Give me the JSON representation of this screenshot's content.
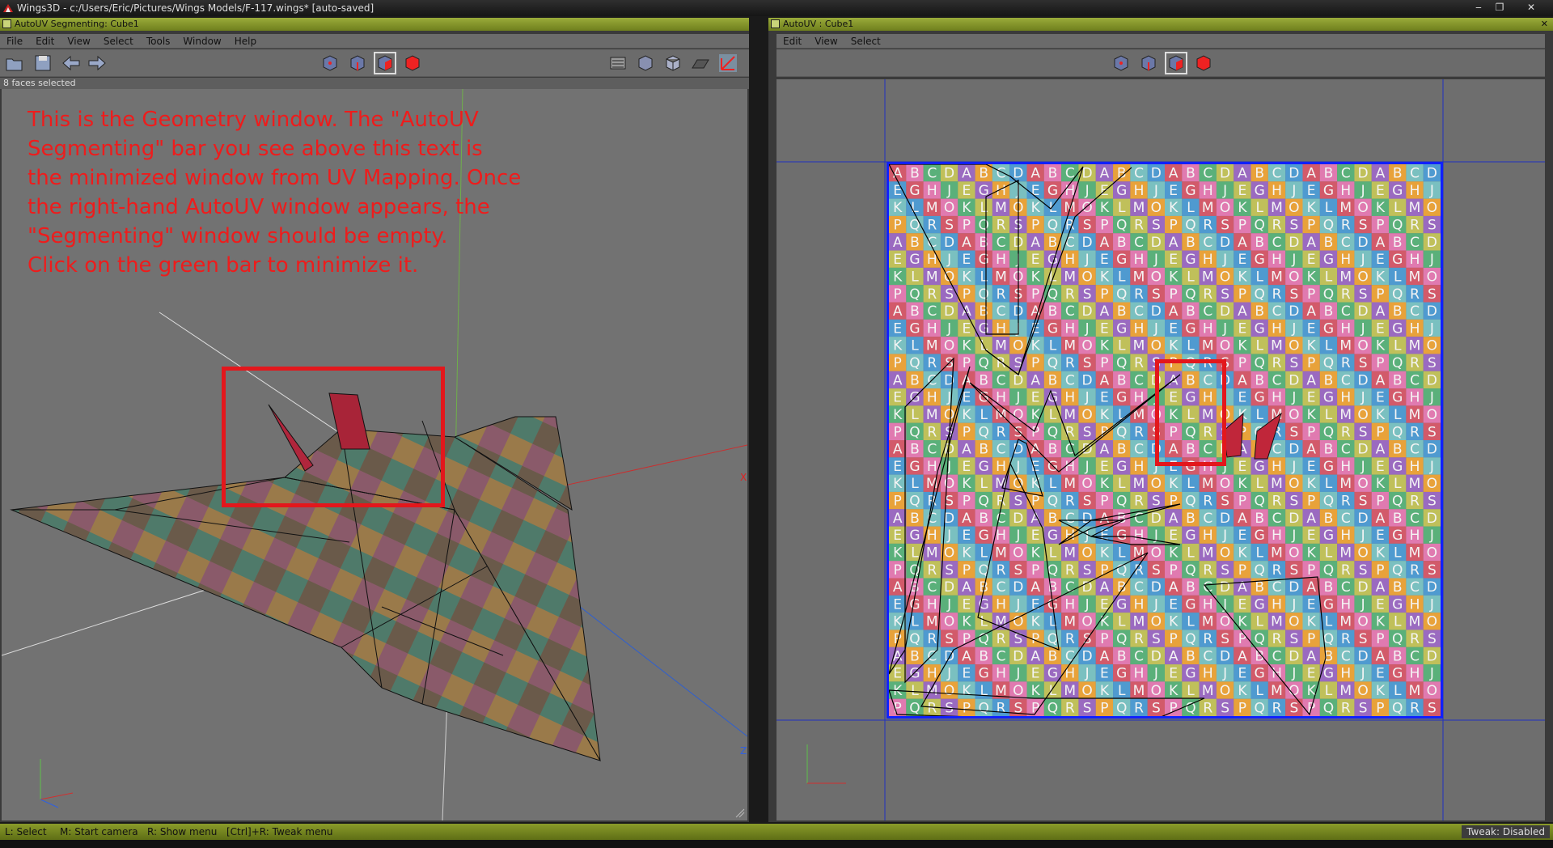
{
  "app": {
    "title": "Wings3D - c:/Users/Eric/Pictures/Wings Models/F-117.wings* [auto-saved]"
  },
  "window_controls": {
    "minimize": "‒",
    "maximize": "❐",
    "close": "✕"
  },
  "left_window": {
    "title": "AutoUV Segmenting: Cube1",
    "menus": [
      "File",
      "Edit",
      "View",
      "Select",
      "Tools",
      "Window",
      "Help"
    ],
    "info": "8 faces selected",
    "annotation": "This is the Geometry window. The \"AutoUV\nSegmenting\" bar you see above this text is\nthe minimized window from UV Mapping. Once\nthe right-hand AutoUV window appears, the\n\"Segmenting\" window should be empty.\nClick on the green bar to minimize it.",
    "axis_x": "X",
    "axis_z": "Z"
  },
  "right_window": {
    "title": "AutoUV : Cube1",
    "close_glyph": "✕",
    "menus": [
      "Edit",
      "View",
      "Select"
    ]
  },
  "texture": {
    "row_patterns": [
      "ABCD",
      "EGHJ",
      "KLMO",
      "PQRS"
    ]
  },
  "status": {
    "hints": [
      "L: Select",
      "M: Start camera",
      "R: Show menu",
      "[Ctrl]+R: Tweak menu"
    ],
    "tweak": "Tweak: Disabled"
  },
  "icons": {
    "toolbar_left": [
      "open-file-icon",
      "save-icon",
      "undo-icon",
      "redo-icon"
    ],
    "select_modes": [
      "vertex-mode-icon",
      "edge-mode-icon",
      "face-mode-icon",
      "body-mode-icon"
    ],
    "view_modes": [
      "perspective-icon",
      "smooth-preview-icon",
      "wireframe-icon",
      "ground-plane-icon",
      "axes-icon"
    ]
  },
  "colors": {
    "accent_green": "#8a9b2a",
    "annotation_red": "#ee1c1c",
    "uv_blue": "#1020ff"
  }
}
